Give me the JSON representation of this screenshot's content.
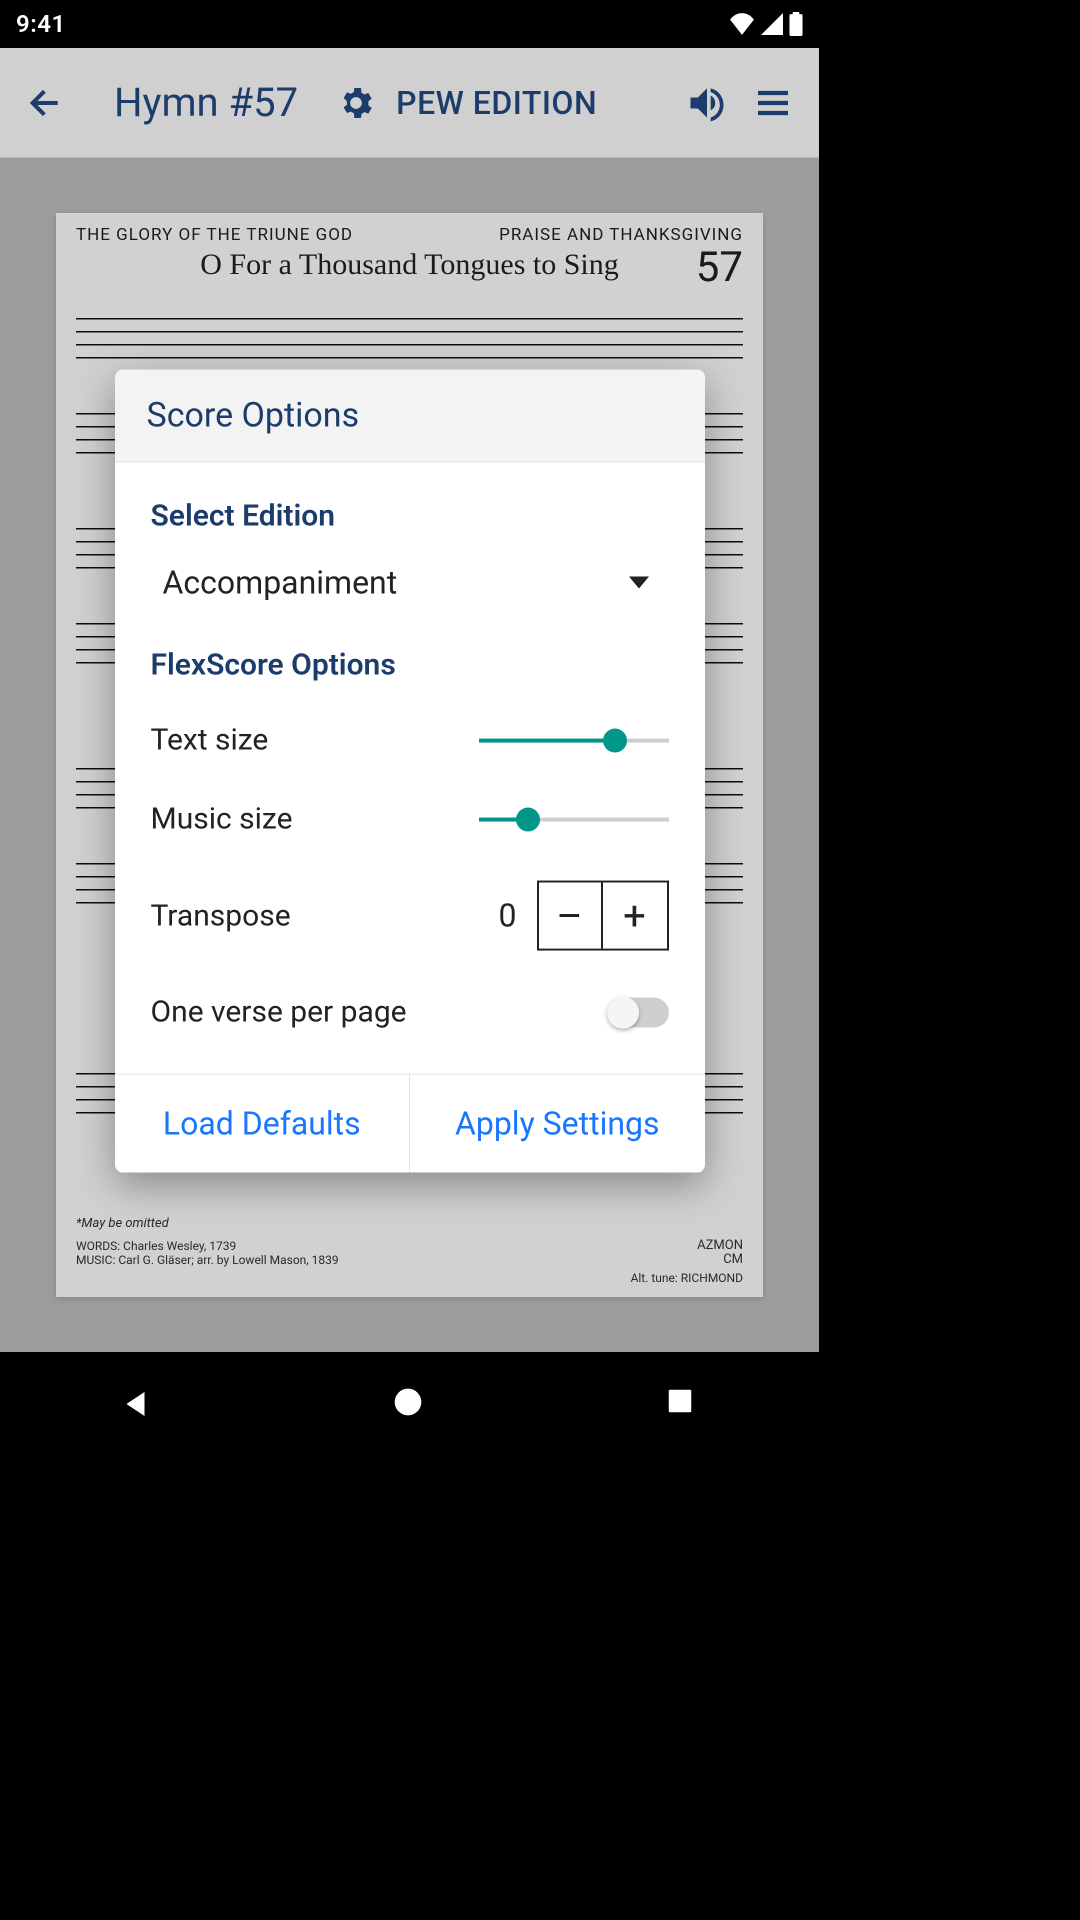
{
  "status": {
    "time": "9:41"
  },
  "toolbar": {
    "title": "Hymn #57",
    "edition": "PEW EDITION"
  },
  "sheet": {
    "hdr_l": "THE GLORY OF THE TRIUNE GOD",
    "hdr_r": "PRAISE AND THANKSGIVING",
    "number": "57",
    "title": "O For a Thousand Tongues to Sing",
    "foot_omit": "*May be omitted",
    "foot_words": "WORDS:  Charles Wesley, 1739",
    "foot_music": "MUSIC:   Carl G. Gläser; arr. by Lowell Mason, 1839",
    "foot_r1": "AZMON",
    "foot_r2": "CM",
    "foot_r3": "Alt. tune: RICHMOND"
  },
  "dialog": {
    "title": "Score Options",
    "select_edition_label": "Select Edition",
    "edition_value": "Accompaniment",
    "flex_label": "FlexScore Options",
    "text_size_label": "Text size",
    "text_size_pct": 72,
    "music_size_label": "Music size",
    "music_size_pct": 26,
    "transpose_label": "Transpose",
    "transpose_value": "0",
    "minus": "–",
    "plus": "+",
    "one_verse_label": "One verse per page",
    "one_verse_on": false,
    "load_defaults": "Load Defaults",
    "apply": "Apply Settings"
  }
}
